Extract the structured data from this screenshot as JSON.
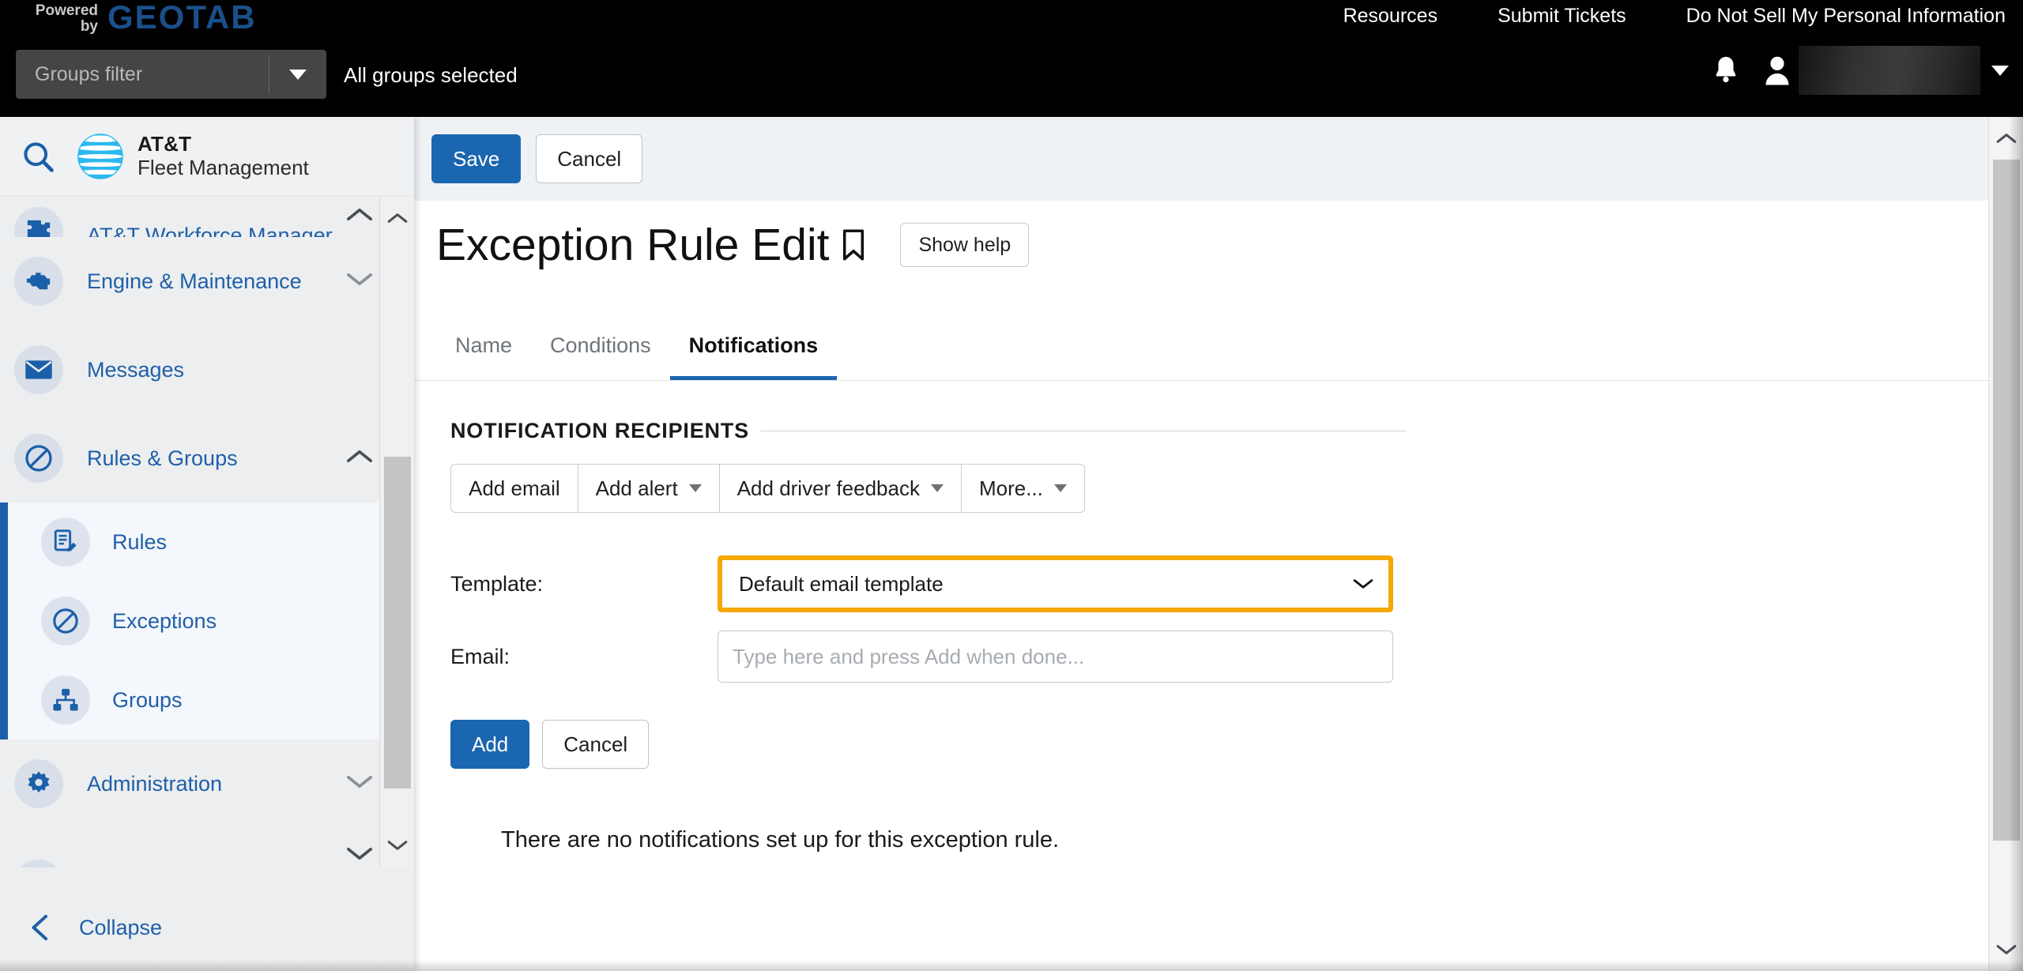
{
  "topbar": {
    "powered_line1": "Powered",
    "powered_line2": "by",
    "brand_logo": "GEOTAB",
    "groups_filter_placeholder": "Groups filter",
    "groups_selected_text": "All groups selected",
    "links": [
      {
        "label": "Resources"
      },
      {
        "label": "Submit Tickets"
      },
      {
        "label": "Do Not Sell My Personal Information"
      }
    ],
    "notification_icon": "bell-icon",
    "user_icon": "user-avatar-icon",
    "user_name_redacted": "",
    "user_caret": "caret-down-icon"
  },
  "sidebar": {
    "search_icon": "search-icon",
    "logo_title_line1": "AT&T",
    "logo_title_line2": "Fleet Management",
    "items": [
      {
        "label": "AT&T Workforce Manager",
        "icon": "puzzle-piece-icon",
        "expandable": true,
        "state": "expanded",
        "cut": "top"
      },
      {
        "label": "Engine & Maintenance",
        "icon": "engine-icon",
        "expandable": true,
        "state": "collapsed"
      },
      {
        "label": "Messages",
        "icon": "envelope-icon",
        "expandable": false
      },
      {
        "label": "Rules & Groups",
        "icon": "prohibited-icon",
        "expandable": true,
        "state": "expanded"
      }
    ],
    "sub_items": [
      {
        "label": "Rules",
        "icon": "rules-edit-icon"
      },
      {
        "label": "Exceptions",
        "icon": "prohibited-icon"
      },
      {
        "label": "Groups",
        "icon": "org-chart-icon"
      }
    ],
    "items_after": [
      {
        "label": "Administration",
        "icon": "gear-icon",
        "expandable": true,
        "state": "collapsed"
      },
      {
        "label": "",
        "icon": "map-pin-icon",
        "expandable": true,
        "state": "collapsed",
        "cut": "bottom"
      }
    ],
    "collapse_label": "Collapse",
    "collapse_icon": "chevron-left-icon"
  },
  "main": {
    "actions": {
      "save_label": "Save",
      "cancel_label": "Cancel"
    },
    "page_title": "Exception Rule Edit",
    "bookmark_icon": "bookmark-icon",
    "show_help_label": "Show help",
    "tabs": [
      {
        "label": "Name",
        "active": false
      },
      {
        "label": "Conditions",
        "active": false
      },
      {
        "label": "Notifications",
        "active": true
      }
    ],
    "section": {
      "heading": "NOTIFICATION RECIPIENTS",
      "buttons": [
        {
          "label": "Add email",
          "has_caret": false
        },
        {
          "label": "Add alert",
          "has_caret": true
        },
        {
          "label": "Add driver feedback",
          "has_caret": true
        },
        {
          "label": "More...",
          "has_caret": true
        }
      ],
      "template_label": "Template:",
      "template_value": "Default email template",
      "template_options": [
        "Default email template"
      ],
      "template_caret_icon": "chevron-down-icon",
      "email_label": "Email:",
      "email_value": "",
      "email_placeholder": "Type here and press Add when done...",
      "add_label": "Add",
      "cancel_label": "Cancel",
      "empty_message": "There are no notifications set up for this exception rule."
    }
  },
  "colors": {
    "primary_blue": "#1b66b0",
    "link_blue": "#1f5fa8",
    "highlight_orange": "#f5a800",
    "header_black": "#000000",
    "sidebar_bg": "#eceef0",
    "action_bar_bg": "#eff2f5",
    "geotab_blue": "#1a4f8a"
  }
}
